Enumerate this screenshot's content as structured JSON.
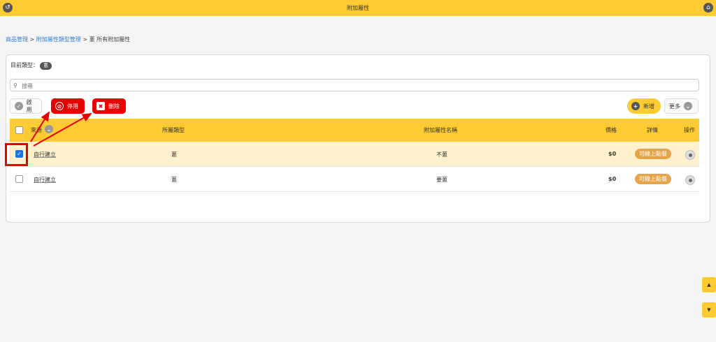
{
  "topbar": {
    "title": "附加屬性"
  },
  "breadcrumb": {
    "item1": "商品管理",
    "sep1": " > ",
    "item2": "附加屬性類型管理",
    "sep2": " > ",
    "current": "蔥 所有附加屬性"
  },
  "panel": {
    "type_label": "目前類型：",
    "type_value": "蔥",
    "search_placeholder": "搜尋"
  },
  "toolbar": {
    "enable_label": "啟用",
    "disable_label": "停用",
    "delete_label": "刪除",
    "add_label": "新增",
    "more_label": "更多"
  },
  "table": {
    "headers": {
      "source": "來源",
      "type": "所屬類型",
      "name": "附加屬性名稱",
      "price": "價格",
      "details": "詳情",
      "actions": "操作"
    },
    "rows": [
      {
        "checked": true,
        "source": "自行建立",
        "type": "蔥",
        "name": "不蔥",
        "price": "$0",
        "details": "可線上點餐"
      },
      {
        "checked": false,
        "source": "自行建立",
        "type": "蔥",
        "name": "要蔥",
        "price": "$0",
        "details": "可線上點餐"
      }
    ]
  },
  "scroll": {
    "up": "▲",
    "down": "▼"
  },
  "colors": {
    "accent": "#fecb33",
    "danger": "#e60000",
    "pill": "#e6a44a",
    "link": "#2f7fd1"
  }
}
